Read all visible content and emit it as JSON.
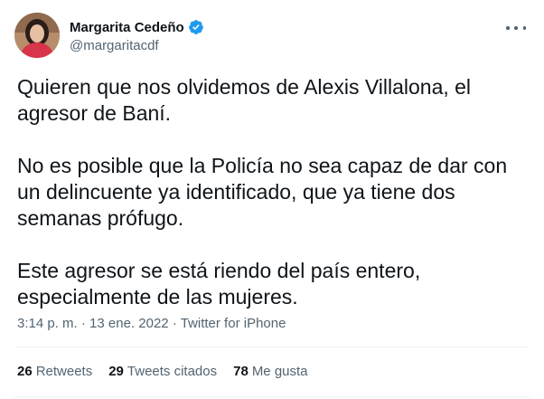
{
  "author": {
    "display_name": "Margarita Cedeño",
    "handle": "@margaritacdf",
    "verified_icon": "verified-badge-icon",
    "more_icon": "more-options-icon"
  },
  "tweet": {
    "paragraphs": [
      "Quieren que nos olvidemos de Alexis Villalona, el agresor de Baní.",
      "No es posible que la Policía no sea capaz de dar con un delincuente ya identificado, que ya tiene dos semanas prófugo.",
      "Este agresor se está riendo del país entero, especialmente de las mujeres."
    ],
    "time": "3:14 p. m.",
    "separator": "·",
    "date": "13 ene. 2022",
    "source": "Twitter for iPhone"
  },
  "stats": {
    "retweets_count": "26",
    "retweets_label": "Retweets",
    "quotes_count": "29",
    "quotes_label": "Tweets citados",
    "likes_count": "78",
    "likes_label": "Me gusta"
  },
  "colors": {
    "verified": "#1d9bf0",
    "secondary_text": "#536471",
    "primary_text": "#0f1419"
  }
}
